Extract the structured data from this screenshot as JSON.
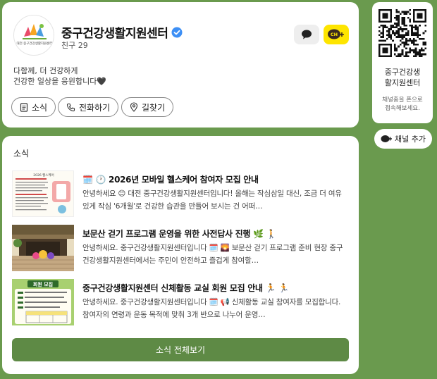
{
  "profile": {
    "name": "중구건강생활지원센터",
    "friends": "친구 29",
    "desc_line1": "다함께, 더 건강하게",
    "desc_line2": "건강한 일상을 응원합니다🖤",
    "ch_badge": "CH",
    "logo_text": "대전 중구건강생활지원센터",
    "buttons": {
      "news": "소식",
      "call": "전화하기",
      "directions": "길찾기"
    }
  },
  "news": {
    "section_title": "소식",
    "items": [
      {
        "title": "🗓️ 🕐 2026년 모바일 헬스케어 참여자 모집 안내",
        "body": "안녕하세요 😊 대전 중구건강생활지원센터입니다! 올해는 작심삼일 대신, 조금 더 여유 있게 작심 '6개월'로 건강한 습관을 만들어 보시는 건 어떠…",
        "thumb_text": "2026 헬스케어"
      },
      {
        "title": "보문산 걷기 프로그램 운영을 위한 사전답사 진행 🌿 🚶",
        "body": "안녕하세요. 중구건강생활지원센터입니다 🗓️ 🌄 보문산 걷기 프로그램 준비 현장 중구건강생활지원센터에서는 주민이 안전하고 즐겁게 참여할…"
      },
      {
        "title": "중구건강생활지원센터 신체활동 교실 회원 모집 안내 🏃 🏃",
        "body": "안녕하세요. 중구건강생활지원센터입니다 🗓️ 📢 신체활동 교실 참여자를 모집합니다. 참여자의 연령과 운동 목적에 맞춰 3개 반으로 나누어 운영…",
        "thumb_text": "회원 모집"
      }
    ],
    "all_button": "소식 전체보기"
  },
  "sidebar": {
    "qr_name_line1": "중구건강생",
    "qr_name_line2": "활지원센터",
    "qr_hint_line1": "채널홈을 폰으로",
    "qr_hint_line2": "접속해보세요.",
    "add_channel": "채널 추가"
  },
  "colors": {
    "background": "#6a9a4e",
    "button_green": "#5e8a45",
    "kakao_yellow": "#fee500",
    "verified_blue": "#3d8ff5"
  }
}
